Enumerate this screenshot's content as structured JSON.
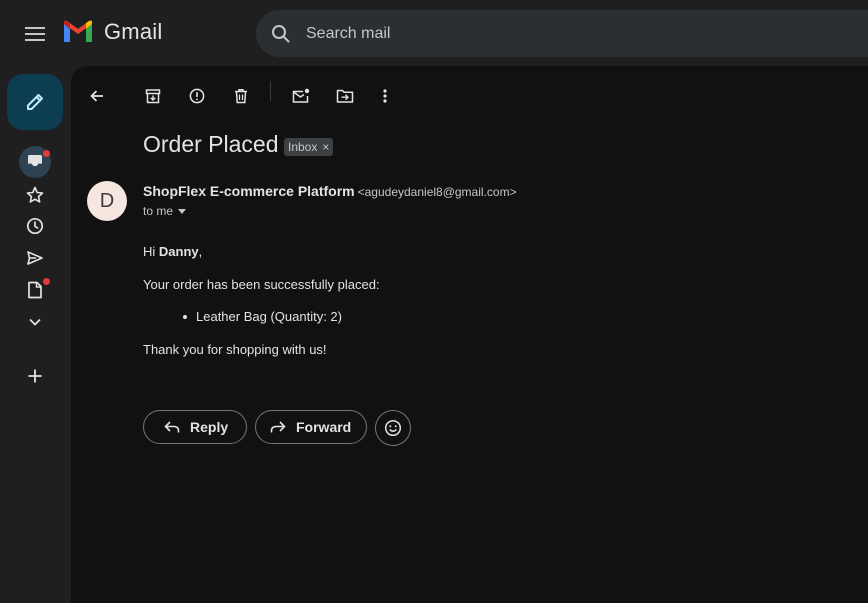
{
  "app": {
    "name": "Gmail"
  },
  "search": {
    "placeholder": "Search mail"
  },
  "nav": {
    "items": [
      {
        "name": "inbox",
        "icon": "inbox-icon",
        "has_dot": true,
        "active": true
      },
      {
        "name": "starred",
        "icon": "star-icon"
      },
      {
        "name": "snoozed",
        "icon": "clock-icon"
      },
      {
        "name": "sent",
        "icon": "send-icon"
      },
      {
        "name": "drafts",
        "icon": "draft-icon",
        "has_dot": true
      },
      {
        "name": "more",
        "icon": "chevron-down-icon"
      }
    ],
    "add_icon": "plus-icon"
  },
  "toolbar": {
    "icons": [
      "back-arrow-icon",
      "archive-icon",
      "report-spam-icon",
      "delete-icon",
      "mark-unread-icon",
      "move-to-icon",
      "more-vert-icon"
    ]
  },
  "email": {
    "subject": "Order Placed",
    "label": "Inbox",
    "label_close": "×",
    "sender": {
      "avatar_letter": "D",
      "name": "ShopFlex E-commerce Platform",
      "email": "<agudeydaniel8@gmail.com>"
    },
    "recipient": "to me",
    "body": {
      "greeting_prefix": "Hi ",
      "greeting_name": "Danny",
      "greeting_suffix": ",",
      "intro": "Your order has been successfully placed:",
      "items": [
        "Leather Bag (Quantity: 2)"
      ],
      "closing": "Thank you for shopping with us!"
    }
  },
  "actions": {
    "reply": "Reply",
    "forward": "Forward",
    "emoji_icon": "emoji-icon"
  },
  "colors": {
    "background": "#1f1f1f",
    "panel": "#111111",
    "compose": "#0d3d50",
    "notification_dot": "#e53935"
  }
}
